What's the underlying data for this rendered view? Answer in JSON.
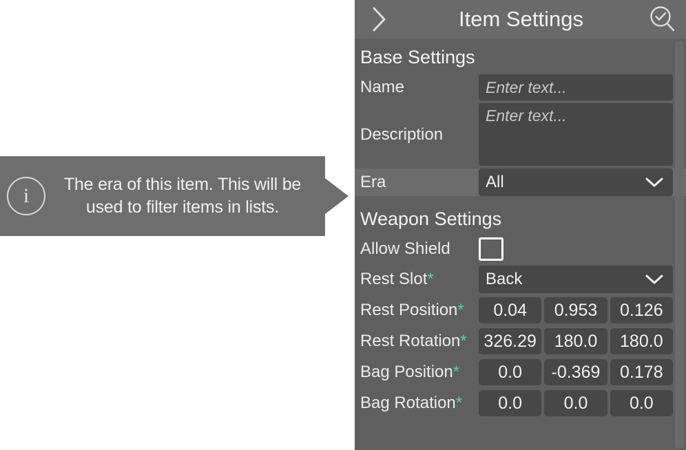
{
  "tooltip": {
    "icon": "info-icon",
    "text": "The era of this item. This will be used to filter items in lists."
  },
  "panel": {
    "header": {
      "back_icon": "chevron-right-icon",
      "title": "Item Settings",
      "action_icon": "search-check-icon"
    },
    "sections": [
      {
        "title": "Base Settings",
        "rows": [
          {
            "label": "Name",
            "required": false,
            "type": "text",
            "value": "",
            "placeholder": "Enter text..."
          },
          {
            "label": "Description",
            "required": false,
            "type": "textarea",
            "value": "",
            "placeholder": "Enter text..."
          },
          {
            "label": "Era",
            "required": false,
            "type": "dropdown",
            "value": "All",
            "highlighted": true
          }
        ]
      },
      {
        "title": "Weapon Settings",
        "rows": [
          {
            "label": "Allow Shield",
            "required": false,
            "type": "checkbox",
            "checked": false
          },
          {
            "label": "Rest Slot",
            "required": true,
            "type": "dropdown",
            "value": "Back"
          },
          {
            "label": "Rest Position",
            "required": true,
            "type": "vector3",
            "values": [
              "0.04",
              "0.953",
              "0.126"
            ]
          },
          {
            "label": "Rest Rotation",
            "required": true,
            "type": "vector3",
            "values": [
              "326.29",
              "180.0",
              "180.0"
            ]
          },
          {
            "label": "Bag Position",
            "required": true,
            "type": "vector3",
            "values": [
              "0.0",
              "-0.369",
              "0.178"
            ]
          },
          {
            "label": "Bag Rotation",
            "required": true,
            "type": "vector3",
            "values": [
              "0.0",
              "0.0",
              "0.0"
            ]
          }
        ]
      }
    ],
    "required_marker": "*",
    "scrollbar": "vertical-scrollbar"
  },
  "colors": {
    "panel_bg": "#5f5f5f",
    "header_bg": "#6a6a6a",
    "field_bg": "#474747",
    "tooltip_bg": "#6e6e6e",
    "text": "#f0f0f0",
    "required_green": "#4ddb8a"
  }
}
